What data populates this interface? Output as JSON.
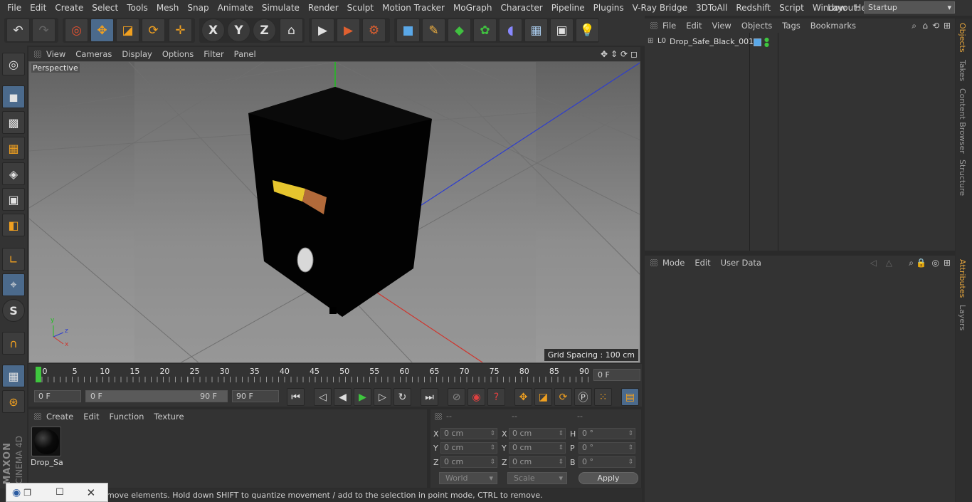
{
  "menubar": {
    "items": [
      "File",
      "Edit",
      "Create",
      "Select",
      "Tools",
      "Mesh",
      "Snap",
      "Animate",
      "Simulate",
      "Render",
      "Sculpt",
      "Motion Tracker",
      "MoGraph",
      "Character",
      "Pipeline",
      "Plugins",
      "V-Ray Bridge",
      "3DToAll",
      "Redshift",
      "Script",
      "Window",
      "Help"
    ],
    "layout_label": "Layout:",
    "layout_value": "Startup"
  },
  "toolbar": {
    "undo_icon": "↶",
    "redo_icon": "↷",
    "select_icon": "◎",
    "move_icon": "✥",
    "scale_icon": "◪",
    "rotate_icon": "⟳",
    "transform_icon": "✛",
    "x_label": "X",
    "y_label": "Y",
    "z_label": "Z",
    "coord_icon": "⌂",
    "render_view_icon": "▶",
    "render_picture_icon": "▶",
    "render_settings_icon": "⚙",
    "cube_icon": "■",
    "pen_icon": "✎",
    "subdiv_icon": "◆",
    "mograph_icon": "✿",
    "deformer_icon": "◖",
    "floor_icon": "▦",
    "camera_icon": "▣",
    "light_icon": "💡"
  },
  "left_tools": {
    "icons": [
      "◎",
      "◼",
      "▩",
      "▦",
      "◈",
      "▣",
      "◧",
      "∟",
      "⌖",
      "S",
      "∩",
      "▦",
      "⊛"
    ]
  },
  "brand": {
    "maxon": "MAXON",
    "c4d": "CINEMA 4D"
  },
  "viewport": {
    "menu": [
      "View",
      "Cameras",
      "Display",
      "Options",
      "Filter",
      "Panel"
    ],
    "label": "Perspective",
    "grid_spacing": "Grid Spacing : 100 cm",
    "axis_x": "x",
    "axis_y": "y",
    "axis_z": "z"
  },
  "timeline": {
    "ticks": [
      "0",
      "5",
      "10",
      "15",
      "20",
      "25",
      "30",
      "35",
      "40",
      "45",
      "50",
      "55",
      "60",
      "65",
      "70",
      "75",
      "80",
      "85",
      "90"
    ],
    "current_frame": "0 F"
  },
  "transport": {
    "start_field": "0 F",
    "range_start": "0 F",
    "range_end": "90 F",
    "end_field": "90 F"
  },
  "material_manager": {
    "menu": [
      "Create",
      "Edit",
      "Function",
      "Texture"
    ],
    "material_name": "Drop_Sa"
  },
  "coordinates": {
    "headers": [
      "--",
      "--",
      "--"
    ],
    "rows": [
      {
        "l1": "X",
        "v1": "0 cm",
        "l2": "X",
        "v2": "0 cm",
        "l3": "H",
        "v3": "0 °"
      },
      {
        "l1": "Y",
        "v1": "0 cm",
        "l2": "Y",
        "v2": "0 cm",
        "l3": "P",
        "v3": "0 °"
      },
      {
        "l1": "Z",
        "v1": "0 cm",
        "l2": "Z",
        "v2": "0 cm",
        "l3": "B",
        "v3": "0 °"
      }
    ],
    "world": "World",
    "scale": "Scale",
    "apply": "Apply"
  },
  "statusbar": {
    "text": "move elements. Hold down SHIFT to quantize movement / add to the selection in point mode, CTRL to remove."
  },
  "object_manager": {
    "menu": [
      "File",
      "Edit",
      "View",
      "Objects",
      "Tags",
      "Bookmarks"
    ],
    "object_name": "Drop_Safe_Black_001",
    "object_prefix": "L0"
  },
  "attribute_manager": {
    "menu": [
      "Mode",
      "Edit",
      "User Data"
    ]
  },
  "right_tabs": [
    "Objects",
    "Takes",
    "Content Browser",
    "Structure",
    "Attributes",
    "Layers"
  ],
  "colors": {
    "accent": "#4b6a8c",
    "tab_active": "#e1a23c",
    "axis_y": "#1fbf1f",
    "axis_x": "#d0342c",
    "axis_z": "#2c3cd0"
  }
}
